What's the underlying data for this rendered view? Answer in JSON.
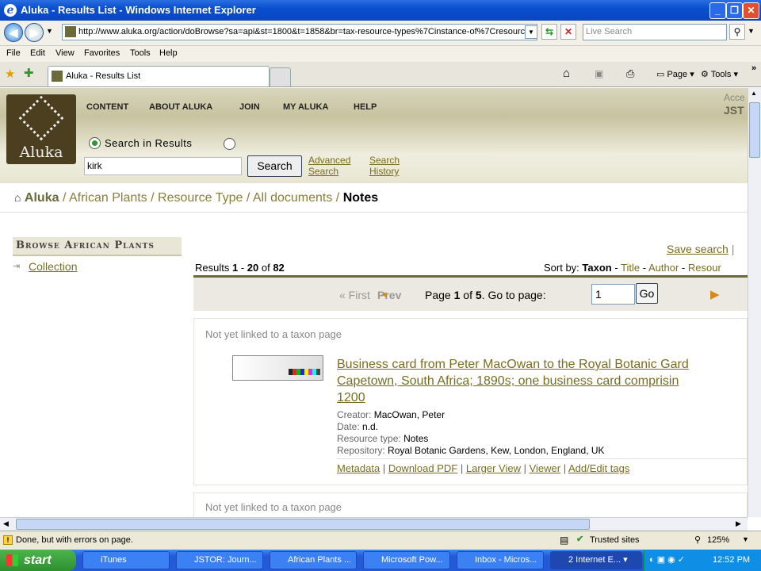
{
  "window": {
    "title": "Aluka - Results List - Windows Internet Explorer"
  },
  "address": {
    "url": "http://www.aluka.org/action/doBrowse?sa=api&st=1800&t=1858&br=tax-resource-types%7Cinstance-of%7Cresource-typ",
    "search_placeholder": "Live Search"
  },
  "menu": [
    "File",
    "Edit",
    "View",
    "Favorites",
    "Tools",
    "Help"
  ],
  "tab": {
    "label": "Aluka - Results List"
  },
  "toolbar": {
    "page": "Page",
    "tools": "Tools"
  },
  "site": {
    "logo": "Aluka",
    "nav": [
      "CONTENT",
      "ABOUT ALUKA",
      "JOIN",
      "MY ALUKA",
      "HELP"
    ],
    "account_line1": "Acce",
    "account_line2": "JST",
    "search_in_results": "Search in Results",
    "search_value": "kirk",
    "search_button": "Search",
    "advanced": "Advanced",
    "advanced2": "Search",
    "history": "Search",
    "history2": "History"
  },
  "breadcrumb": {
    "home": "Aluka",
    "items": [
      "African Plants",
      "Resource Type",
      "All documents"
    ],
    "current": "Notes"
  },
  "sidebar": {
    "heading": "Browse African Plants",
    "items": [
      "Collection"
    ]
  },
  "results": {
    "save_search": "Save search",
    "label": "Results",
    "from": "1",
    "to": "20",
    "of": "82",
    "sort_label": "Sort by:",
    "sort_active": "Taxon",
    "sort_options": [
      "Title",
      "Author",
      "Resour"
    ],
    "pager": {
      "first": "« First",
      "prev": "Prev",
      "page_word": "Page",
      "page": "1",
      "of_word": "of",
      "total": "5",
      "goto": "Go to page:",
      "goto_value": "1",
      "go": "Go"
    }
  },
  "items": [
    {
      "note": "Not yet linked to a taxon page",
      "title_l1": "Business card from Peter MacOwan to the Royal Botanic Gard",
      "title_l2": "Capetown, South Africa; 1890s; one business card comprisin",
      "title_l3": "1200",
      "creator_label": "Creator:",
      "creator": "MacOwan, Peter",
      "date_label": "Date:",
      "date": "n.d.",
      "type_label": "Resource type:",
      "type": "Notes",
      "repo_label": "Repository:",
      "repo": "Royal Botanic Gardens, Kew, London, England, UK",
      "actions": [
        "Metadata",
        "Download PDF",
        "Larger View",
        "Viewer",
        "Add/Edit tags"
      ]
    },
    {
      "note": "Not yet linked to a taxon page"
    }
  ],
  "status": {
    "text": "Done, but with errors on page.",
    "zone": "Trusted sites",
    "zoom": "125%"
  },
  "taskbar": {
    "start": "start",
    "tasks": [
      "iTunes",
      "JSTOR: Journ...",
      "African Plants ...",
      "Microsoft Pow...",
      "Inbox - Micros...",
      "2 Internet E..."
    ],
    "time": "12:52 PM"
  }
}
